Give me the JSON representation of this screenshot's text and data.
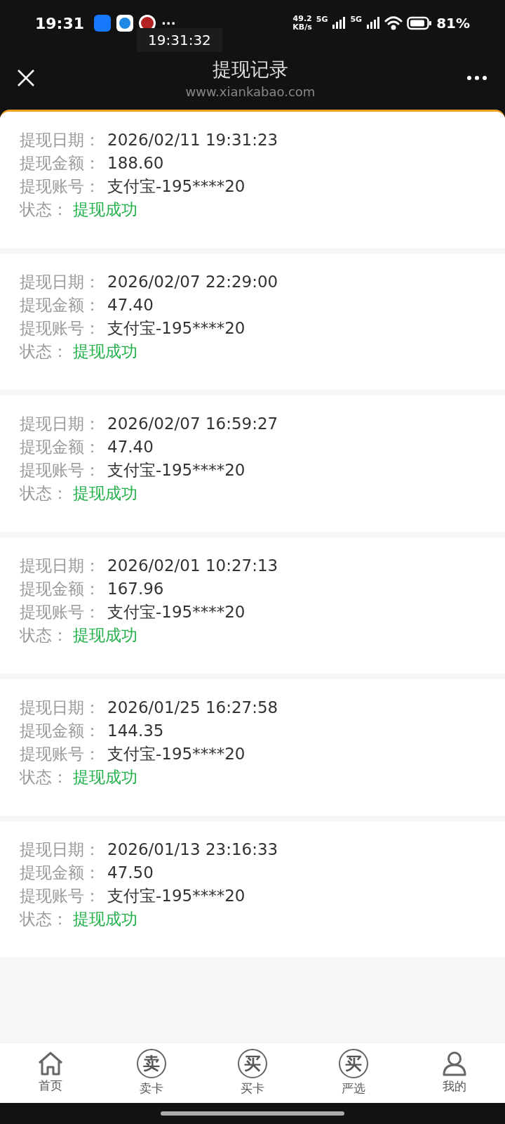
{
  "status_bar": {
    "time": "19:31",
    "network_speed": "49.2",
    "network_unit": "KB/s",
    "sim_1": "5G",
    "sim_2": "5G",
    "battery": "81%",
    "more": "···"
  },
  "clock_overlay": "19:31:32",
  "header": {
    "title": "提现记录",
    "subtitle": "www.xiankabao.com"
  },
  "records": [
    {
      "fields": [
        {
          "kind": "date",
          "label": "提现日期：",
          "value": "2026/02/11 19:31:23"
        },
        {
          "kind": "amount",
          "label": "提现金额：",
          "value": "188.60"
        },
        {
          "kind": "account",
          "label": "提现账号：",
          "value": "支付宝-195****20"
        },
        {
          "kind": "status",
          "label": "状态：",
          "value": "提现成功"
        }
      ]
    },
    {
      "fields": [
        {
          "kind": "date",
          "label": "提现日期：",
          "value": "2026/02/07 22:29:00"
        },
        {
          "kind": "amount",
          "label": "提现金额：",
          "value": "47.40"
        },
        {
          "kind": "account",
          "label": "提现账号：",
          "value": "支付宝-195****20"
        },
        {
          "kind": "status",
          "label": "状态：",
          "value": "提现成功"
        }
      ]
    },
    {
      "fields": [
        {
          "kind": "date",
          "label": "提现日期：",
          "value": "2026/02/07 16:59:27"
        },
        {
          "kind": "amount",
          "label": "提现金额：",
          "value": "47.40"
        },
        {
          "kind": "account",
          "label": "提现账号：",
          "value": "支付宝-195****20"
        },
        {
          "kind": "status",
          "label": "状态：",
          "value": "提现成功"
        }
      ]
    },
    {
      "fields": [
        {
          "kind": "date",
          "label": "提现日期：",
          "value": "2026/02/01 10:27:13"
        },
        {
          "kind": "amount",
          "label": "提现金额：",
          "value": "167.96"
        },
        {
          "kind": "account",
          "label": "提现账号：",
          "value": "支付宝-195****20"
        },
        {
          "kind": "status",
          "label": "状态：",
          "value": "提现成功"
        }
      ]
    },
    {
      "fields": [
        {
          "kind": "date",
          "label": "提现日期：",
          "value": "2026/01/25 16:27:58"
        },
        {
          "kind": "amount",
          "label": "提现金额：",
          "value": "144.35"
        },
        {
          "kind": "account",
          "label": "提现账号：",
          "value": "支付宝-195****20"
        },
        {
          "kind": "status",
          "label": "状态：",
          "value": "提现成功"
        }
      ]
    },
    {
      "fields": [
        {
          "kind": "date",
          "label": "提现日期：",
          "value": "2026/01/13 23:16:33"
        },
        {
          "kind": "amount",
          "label": "提现金额：",
          "value": "47.50"
        },
        {
          "kind": "account",
          "label": "提现账号：",
          "value": "支付宝-195****20"
        },
        {
          "kind": "status",
          "label": "状态：",
          "value": "提现成功"
        }
      ]
    }
  ],
  "nav": [
    {
      "kind": "home",
      "label": "首页"
    },
    {
      "kind": "glyph",
      "glyph": "卖",
      "label": "卖卡"
    },
    {
      "kind": "glyph",
      "glyph": "买",
      "label": "买卡"
    },
    {
      "kind": "glyph",
      "glyph": "买",
      "label": "严选"
    },
    {
      "kind": "user",
      "label": "我的"
    }
  ]
}
